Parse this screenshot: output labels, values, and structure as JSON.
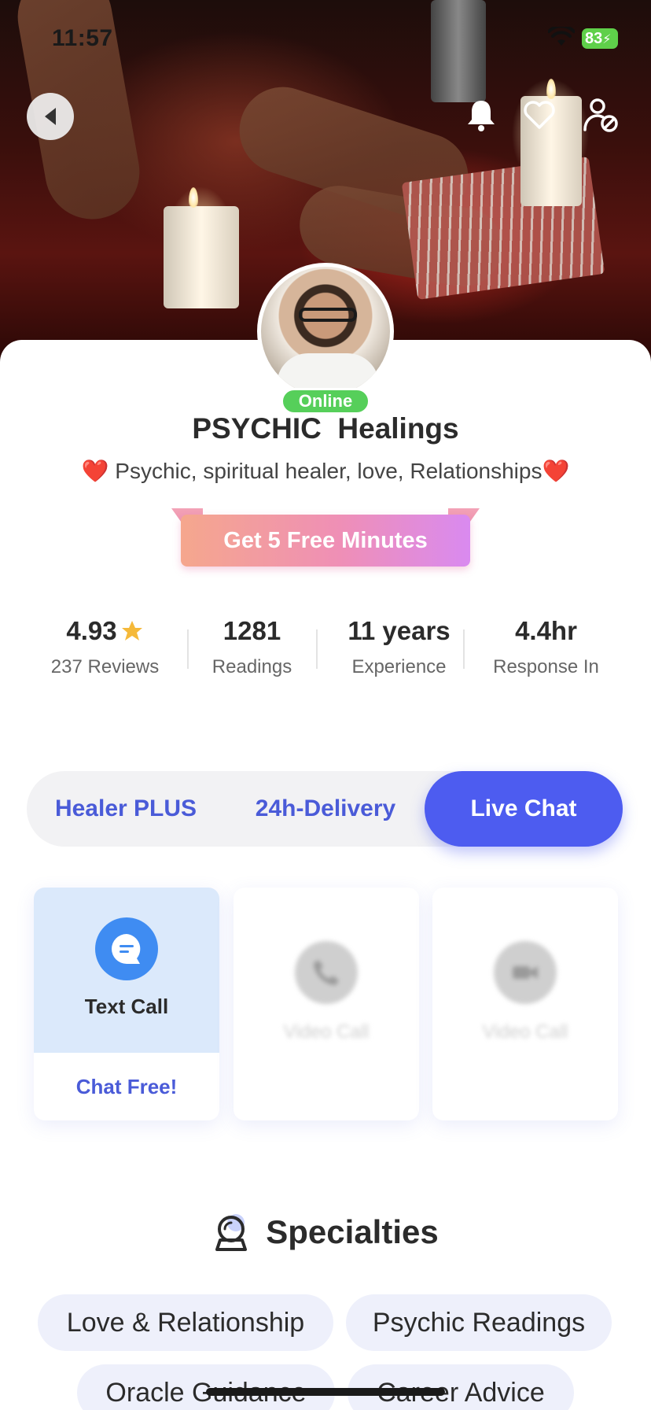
{
  "status_bar": {
    "time": "11:57",
    "battery": "83"
  },
  "profile": {
    "status": "Online",
    "name": "PSYCHIC  Healings",
    "tagline": "❤️ Psychic, spiritual healer, love, Relationships❤️"
  },
  "promo": {
    "label": "Get 5 Free Minutes"
  },
  "stats": [
    {
      "value": "4.93",
      "label": "237 Reviews"
    },
    {
      "value": "1281",
      "label": "Readings"
    },
    {
      "value": "11 years",
      "label": "Experience"
    },
    {
      "value": "4.4hr",
      "label": "Response In"
    }
  ],
  "tabs": [
    {
      "label": "Healer PLUS"
    },
    {
      "label": "24h-Delivery"
    },
    {
      "label": "Live Chat"
    }
  ],
  "service_cards": [
    {
      "title": "Text Call",
      "action": "Chat Free!"
    },
    {
      "title": "Video Call"
    },
    {
      "title": "Video Call"
    }
  ],
  "specialties": {
    "title": "Specialties",
    "items": [
      "Love & Relationship",
      "Psychic Readings",
      "Oracle Guidance",
      "Career Advice"
    ]
  },
  "colors": {
    "accent": "#4d5cf0",
    "online": "#56cf5a",
    "star": "#f5b93a",
    "chip_bg": "#eef0fb"
  }
}
